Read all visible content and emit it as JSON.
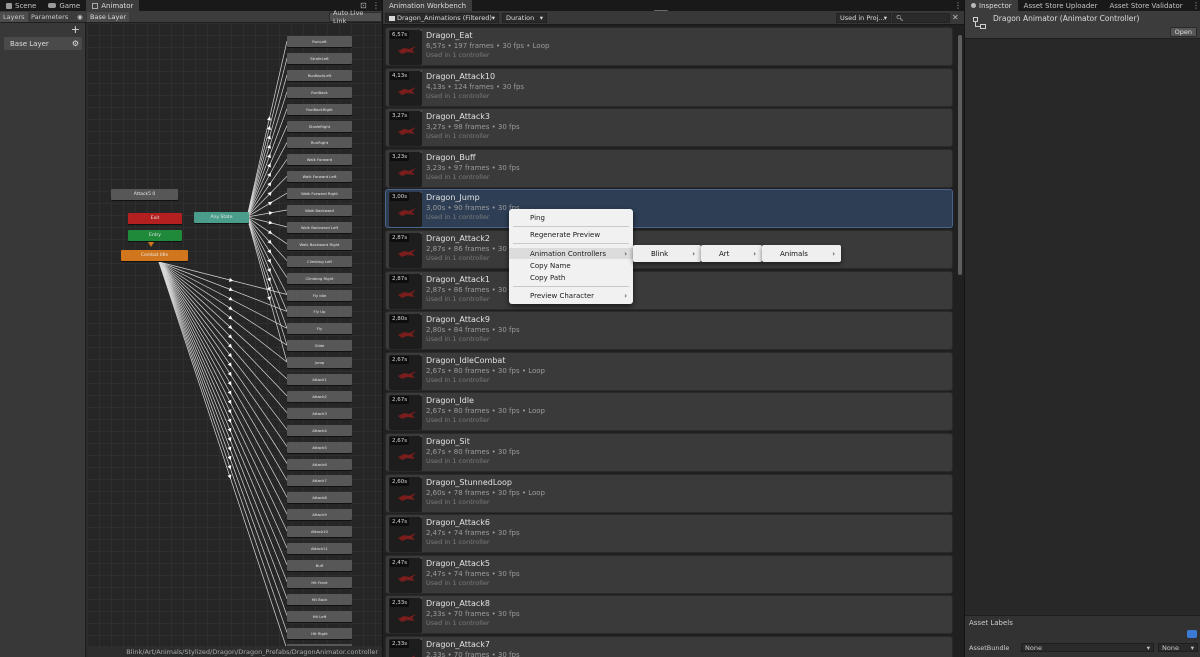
{
  "animator_window": {
    "tabs": [
      {
        "label": "Scene",
        "icon": "scene-icon"
      },
      {
        "label": "Game",
        "icon": "game-icon"
      },
      {
        "label": "Animator",
        "icon": "animator-icon"
      }
    ],
    "subtabs": {
      "layers": "Layers",
      "parameters": "Parameters"
    },
    "breadcrumb": "Base Layer",
    "auto_live_link": "Auto Live Link",
    "add_label": "+",
    "layer_name": "Base Layer",
    "path": "Blink/Art/Animals/Stylized/Dragon/Dragon_Prefabs/DragonAnimator.controller",
    "left_nodes": {
      "attack": "Attack5 0",
      "exit": "Exit",
      "entry": "Entry",
      "combat": "Combat Idle"
    },
    "any_state": "Any State",
    "state_nodes": [
      "RunLeft",
      "StrafeLeft",
      "RunBackLeft",
      "RunBack",
      "RunBackRight",
      "StrafeRight",
      "RunRight",
      "Walk Forward",
      "Walk Forward Left",
      "Walk Forward Right",
      "Walk Backward",
      "Walk Backward Left",
      "Walk Backward Right",
      "Climbing Left",
      "Climbing Right",
      "Fly Idle",
      "Fly Up",
      "Fly",
      "Glide",
      "Jump",
      "Attack1",
      "Attack2",
      "Attack3",
      "Attack4",
      "Attack5",
      "Attack6",
      "Attack7",
      "Attack8",
      "Attack9",
      "Attack10",
      "Attack11",
      "Buff",
      "Hit Front",
      "Hit Back",
      "Hit Left",
      "Hit Right",
      "Stunned Loop"
    ]
  },
  "workbench": {
    "tab": "Animation Workbench",
    "folder_filter": "Dragon_Animations (Filtered)",
    "sort": "Duration",
    "used_filter": "Used in Proj...",
    "search_placeholder": "",
    "clips": [
      {
        "name": "Dragon_Eat",
        "duration": "6,57s",
        "info": "6,57s • 197 frames • 30 fps • Loop",
        "used": "Used in 1 controller"
      },
      {
        "name": "Dragon_Attack10",
        "duration": "4,13s",
        "info": "4,13s • 124 frames • 30 fps",
        "used": "Used in 1 controller"
      },
      {
        "name": "Dragon_Attack3",
        "duration": "3,27s",
        "info": "3,27s • 98 frames • 30 fps",
        "used": "Used in 1 controller"
      },
      {
        "name": "Dragon_Buff",
        "duration": "3,23s",
        "info": "3,23s • 97 frames • 30 fps",
        "used": "Used in 1 controller"
      },
      {
        "name": "Dragon_Jump",
        "duration": "3,00s",
        "info": "3,00s • 90 frames • 30 fps",
        "used": "Used in 1 controller"
      },
      {
        "name": "Dragon_Attack2",
        "duration": "2,87s",
        "info": "2,87s • 86 frames • 30 fps",
        "used": "Used in 1 controller"
      },
      {
        "name": "Dragon_Attack1",
        "duration": "2,87s",
        "info": "2,87s • 86 frames • 30 fps",
        "used": "Used in 1 controller"
      },
      {
        "name": "Dragon_Attack9",
        "duration": "2,80s",
        "info": "2,80s • 84 frames • 30 fps",
        "used": "Used in 1 controller"
      },
      {
        "name": "Dragon_IdleCombat",
        "duration": "2,67s",
        "info": "2,67s • 80 frames • 30 fps • Loop",
        "used": "Used in 1 controller"
      },
      {
        "name": "Dragon_Idle",
        "duration": "2,67s",
        "info": "2,67s • 80 frames • 30 fps • Loop",
        "used": "Used in 1 controller"
      },
      {
        "name": "Dragon_Sit",
        "duration": "2,67s",
        "info": "2,67s • 80 frames • 30 fps",
        "used": "Used in 1 controller"
      },
      {
        "name": "Dragon_StunnedLoop",
        "duration": "2,60s",
        "info": "2,60s • 78 frames • 30 fps • Loop",
        "used": "Used in 1 controller"
      },
      {
        "name": "Dragon_Attack6",
        "duration": "2,47s",
        "info": "2,47s • 74 frames • 30 fps",
        "used": "Used in 1 controller"
      },
      {
        "name": "Dragon_Attack5",
        "duration": "2,47s",
        "info": "2,47s • 74 frames • 30 fps",
        "used": "Used in 1 controller"
      },
      {
        "name": "Dragon_Attack8",
        "duration": "2,33s",
        "info": "2,33s • 70 frames • 30 fps",
        "used": "Used in 1 controller"
      },
      {
        "name": "Dragon_Attack7",
        "duration": "2,33s",
        "info": "2,33s • 70 frames • 30 fps",
        "used": "Used in 1 controller"
      }
    ],
    "context_menu": {
      "items": [
        "Ping",
        "Regenerate Preview",
        "Animation Controllers",
        "Copy Name",
        "Copy Path",
        "Preview Character"
      ],
      "submenu_path": [
        "Blink",
        "Art",
        "Animals"
      ]
    }
  },
  "inspector": {
    "tabs": [
      "Inspector",
      "Asset Store Uploader",
      "Asset Store Validator"
    ],
    "title": "Dragon Animator (Animator Controller)",
    "open": "Open",
    "asset_labels": "Asset Labels",
    "asset_bundle_label": "AssetBundle",
    "bundle_value": "None",
    "variant_value": "None"
  },
  "colors": {
    "exit_node": "#b3201f",
    "entry_node": "#1f8a3a",
    "default_node": "#d1761c",
    "any_state_node": "#4a9d8a",
    "selection": "#2e3f55",
    "clip_red": "#7a1d1d"
  }
}
